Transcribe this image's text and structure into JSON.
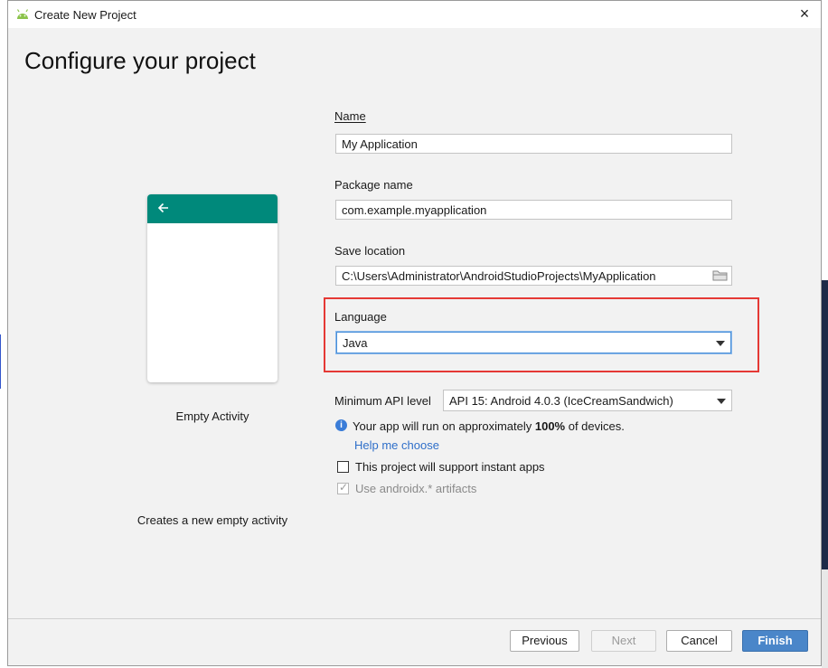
{
  "window": {
    "title": "Create New Project",
    "close_label": "×"
  },
  "header": {
    "page_title": "Configure your project"
  },
  "template": {
    "name": "Empty Activity",
    "description": "Creates a new empty activity",
    "appbar_color": "#00897b"
  },
  "form": {
    "name_label": "Name",
    "name_value": "My Application",
    "package_label": "Package name",
    "package_value": "com.example.myapplication",
    "save_location_label": "Save location",
    "save_location_value": "C:\\Users\\Administrator\\AndroidStudioProjects\\MyApplication",
    "language_label": "Language",
    "language_value": "Java",
    "min_api_label": "Minimum API level",
    "min_api_value": "API 15: Android 4.0.3 (IceCreamSandwich)",
    "info_prefix": "Your app will run on approximately ",
    "info_percent": "100%",
    "info_suffix": " of devices.",
    "help_link": "Help me choose",
    "instant_apps_label": "This project will support instant apps",
    "instant_apps_checked": false,
    "androidx_label": "Use androidx.* artifacts",
    "androidx_checked": true
  },
  "buttons": {
    "previous": "Previous",
    "next": "Next",
    "cancel": "Cancel",
    "finish": "Finish"
  },
  "colors": {
    "highlight_box": "#e53935",
    "primary_button": "#4a86c9",
    "link": "#2f6fc9"
  }
}
